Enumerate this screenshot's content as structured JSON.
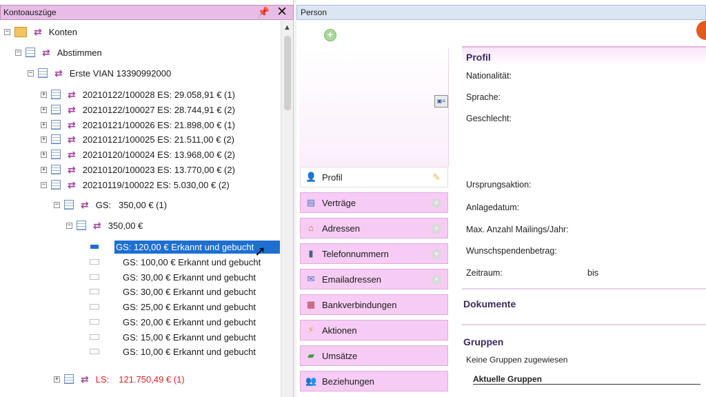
{
  "left_panel": {
    "title": "Kontoauszüge",
    "tree": {
      "root": "Konten",
      "level1": "Abstimmen",
      "level2": "Erste VIAN 13390992000",
      "statements": [
        "20210122/100028 ES: 29.058,91 € (1)",
        "20210122/100027 ES: 28.744,91 € (2)",
        "20210121/100026 ES: 21.898,00 € (1)",
        "20210121/100025 ES: 21.511,00 € (2)",
        "20210120/100024 ES: 13.968,00 € (2)",
        "20210120/100023 ES: 13.770,00 € (2)",
        "20210119/100022 ES: 5.030,00 € (2)"
      ],
      "gs_group": "GS:   350,00 € (1)",
      "gs_sub": "350,00 €",
      "entries": [
        "GS: 120,00 € Erkannt und gebucht",
        "GS: 100,00 € Erkannt und gebucht",
        "GS: 30,00 € Erkannt und gebucht",
        "GS: 30,00 € Erkannt und gebucht",
        "GS: 25,00 € Erkannt und gebucht",
        "GS: 20,00 € Erkannt und gebucht",
        "GS: 15,00 € Erkannt und gebucht",
        "GS: 10,00 € Erkannt und gebucht"
      ],
      "ls_prefix": "LS:",
      "ls_value": "121.750,49 € (1)"
    }
  },
  "right_panel": {
    "title": "Person",
    "nav": [
      {
        "label": "Profil",
        "icon": "person-icon"
      },
      {
        "label": "Verträge",
        "icon": "document-icon"
      },
      {
        "label": "Adressen",
        "icon": "house-icon"
      },
      {
        "label": "Telefonnummern",
        "icon": "phone-icon"
      },
      {
        "label": "Emailadressen",
        "icon": "mail-icon"
      },
      {
        "label": "Bankverbindungen",
        "icon": "bank-icon"
      },
      {
        "label": "Aktionen",
        "icon": "lightning-icon"
      },
      {
        "label": "Umsätze",
        "icon": "money-icon"
      },
      {
        "label": "Beziehungen",
        "icon": "people-icon"
      }
    ],
    "profile": {
      "title": "Profil",
      "nationalitaet": "Nationalität:",
      "sprache": "Sprache:",
      "geschlecht": "Geschlecht:",
      "ursprungsaktion": "Ursprungsaktion:",
      "anlagedatum": "Anlagedatum:",
      "max_mailings": "Max. Anzahl Mailings/Jahr:",
      "wunschspende": "Wunschspendenbetrag:",
      "zeitraum": "Zeitraum:",
      "bis": "bis"
    },
    "dokumente_title": "Dokumente",
    "gruppen_title": "Gruppen",
    "gruppen_none": "Keine Gruppen zugewiesen",
    "aktuelle_gruppen": "Aktuelle Gruppen"
  }
}
